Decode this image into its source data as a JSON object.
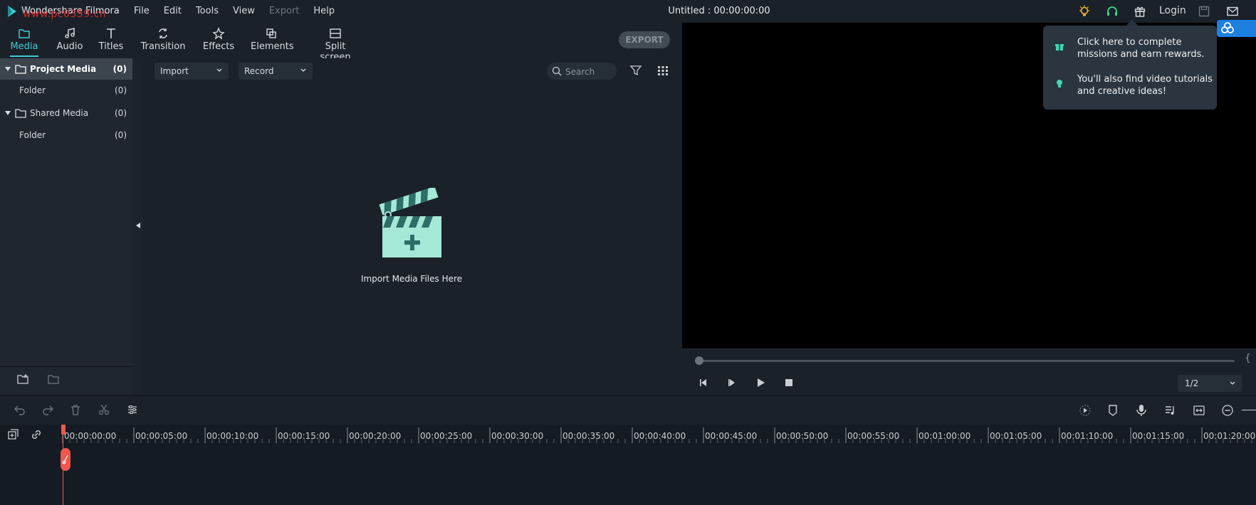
{
  "titlebar": {
    "app_title": "Wondershare Filmora",
    "watermark": "www.pc0359.cn",
    "project_title": "Untitled : 00:00:00:00",
    "menu": [
      "File",
      "Edit",
      "Tools",
      "View",
      "Export",
      "Help"
    ],
    "login_label": "Login"
  },
  "toolbar": {
    "tabs": [
      {
        "label": "Media",
        "icon": "folder-icon"
      },
      {
        "label": "Audio",
        "icon": "music-note-icon"
      },
      {
        "label": "Titles",
        "icon": "text-icon"
      },
      {
        "label": "Transition",
        "icon": "transition-icon"
      },
      {
        "label": "Effects",
        "icon": "effects-icon"
      },
      {
        "label": "Elements",
        "icon": "elements-icon"
      },
      {
        "label": "Split screen",
        "icon": "split-screen-icon"
      }
    ],
    "active_tab": "Media",
    "export_label": "EXPORT"
  },
  "sidebar": {
    "items": [
      {
        "label": "Project Media",
        "count": "(0)"
      },
      {
        "label": "Folder",
        "count": "(0)"
      },
      {
        "label": "Shared Media",
        "count": "(0)"
      },
      {
        "label": "Folder",
        "count": "(0)"
      }
    ]
  },
  "media": {
    "import_dropdown": "Import",
    "record_dropdown": "Record",
    "search_placeholder": "Search",
    "import_hint": "Import Media Files Here"
  },
  "preview": {
    "ratio": "1/2",
    "bracket": "{"
  },
  "tooltip": {
    "line1": "Click here to complete missions and earn rewards.",
    "line2": "You'll also find video tutorials and creative ideas!"
  },
  "timeline": {
    "ticks": [
      "00:00:00:00",
      "00:00:05:00",
      "00:00:10:00",
      "00:00:15:00",
      "00:00:20:00",
      "00:00:25:00",
      "00:00:30:00",
      "00:00:35:00",
      "00:00:40:00",
      "00:00:45:00",
      "00:00:50:00",
      "00:00:55:00",
      "00:01:00:00",
      "00:01:05:00",
      "00:01:10:00",
      "00:01:15:00",
      "00:01:20:00"
    ]
  },
  "colors": {
    "accent": "#3fcbd6",
    "playhead": "#f0574f",
    "watermark": "#d42a2a",
    "background": "#1a2129"
  }
}
